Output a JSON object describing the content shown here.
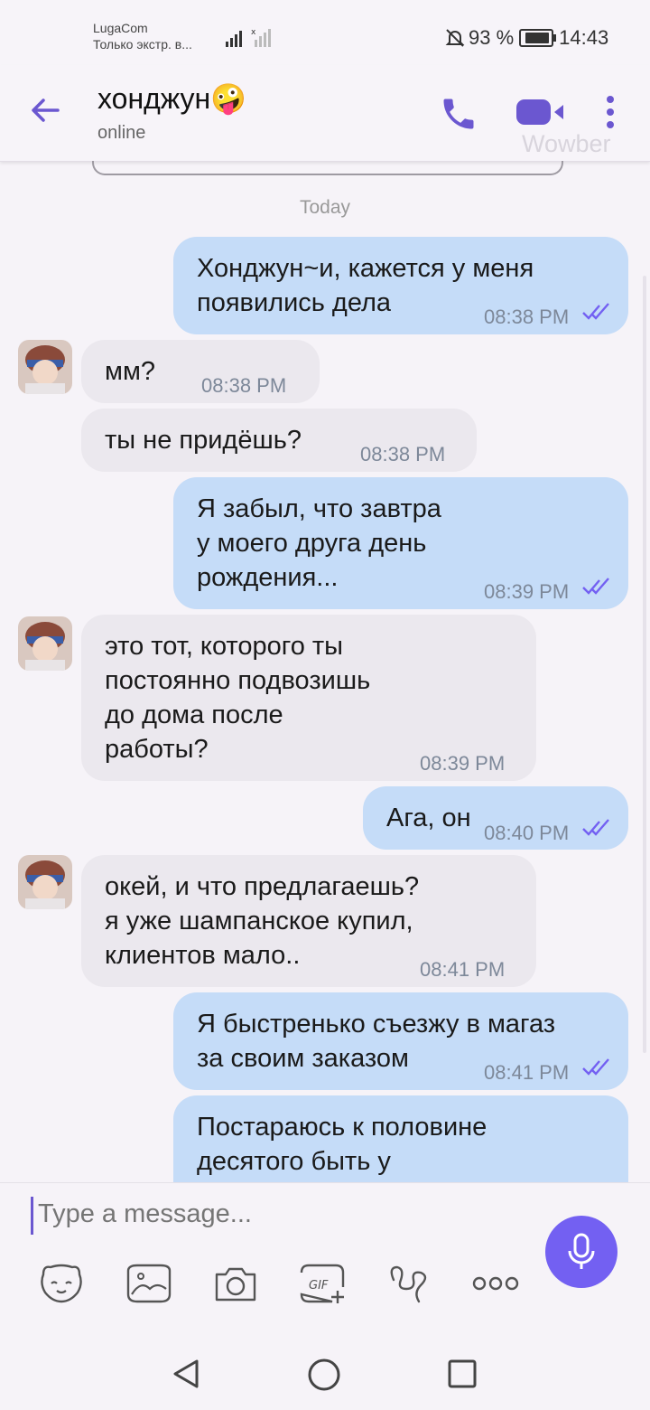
{
  "status_bar": {
    "carrier": "LugaCom",
    "carrier_status": "Только экстр. в...",
    "battery": "93 %",
    "time": "14:43"
  },
  "header": {
    "contact_name": "хонджун🤪",
    "contact_status": "online",
    "watermark": "Wowber"
  },
  "chat": {
    "date_separator": "Today",
    "messages": [
      {
        "dir": "out",
        "text": "Хонджун~и, кажется у меня\nпоявились дела",
        "time": "08:38 PM"
      },
      {
        "dir": "in",
        "text": "мм?",
        "time": "08:38 PM"
      },
      {
        "dir": "in",
        "text": "ты не придёшь?",
        "time": "08:38 PM"
      },
      {
        "dir": "out",
        "text": "Я забыл, что завтра\nу моего друга день\nрождения...",
        "time": "08:39 PM"
      },
      {
        "dir": "in",
        "text": "это тот, которого ты\nпостоянно подвозишь\nдо дома после\nработы?",
        "time": "08:39 PM"
      },
      {
        "dir": "out",
        "text": "Ага, он",
        "time": "08:40 PM"
      },
      {
        "dir": "in",
        "text": "окей, и что предлагаешь?\nя уже шампанское купил,\nклиентов мало..",
        "time": "08:41 PM"
      },
      {
        "dir": "out",
        "text": "Я быстренько съезжу в магаз\nза своим заказом",
        "time": "08:41 PM"
      },
      {
        "dir": "out",
        "text": " Постараюсь к половине\nдесятого быть у",
        "time": ""
      }
    ]
  },
  "composer": {
    "placeholder": "Type a message..."
  },
  "icons": {
    "accent": "#7360f2",
    "toolbar": [
      "sticker-icon",
      "image-icon",
      "camera-icon",
      "gif-icon",
      "doodle-icon",
      "more-icon"
    ]
  }
}
